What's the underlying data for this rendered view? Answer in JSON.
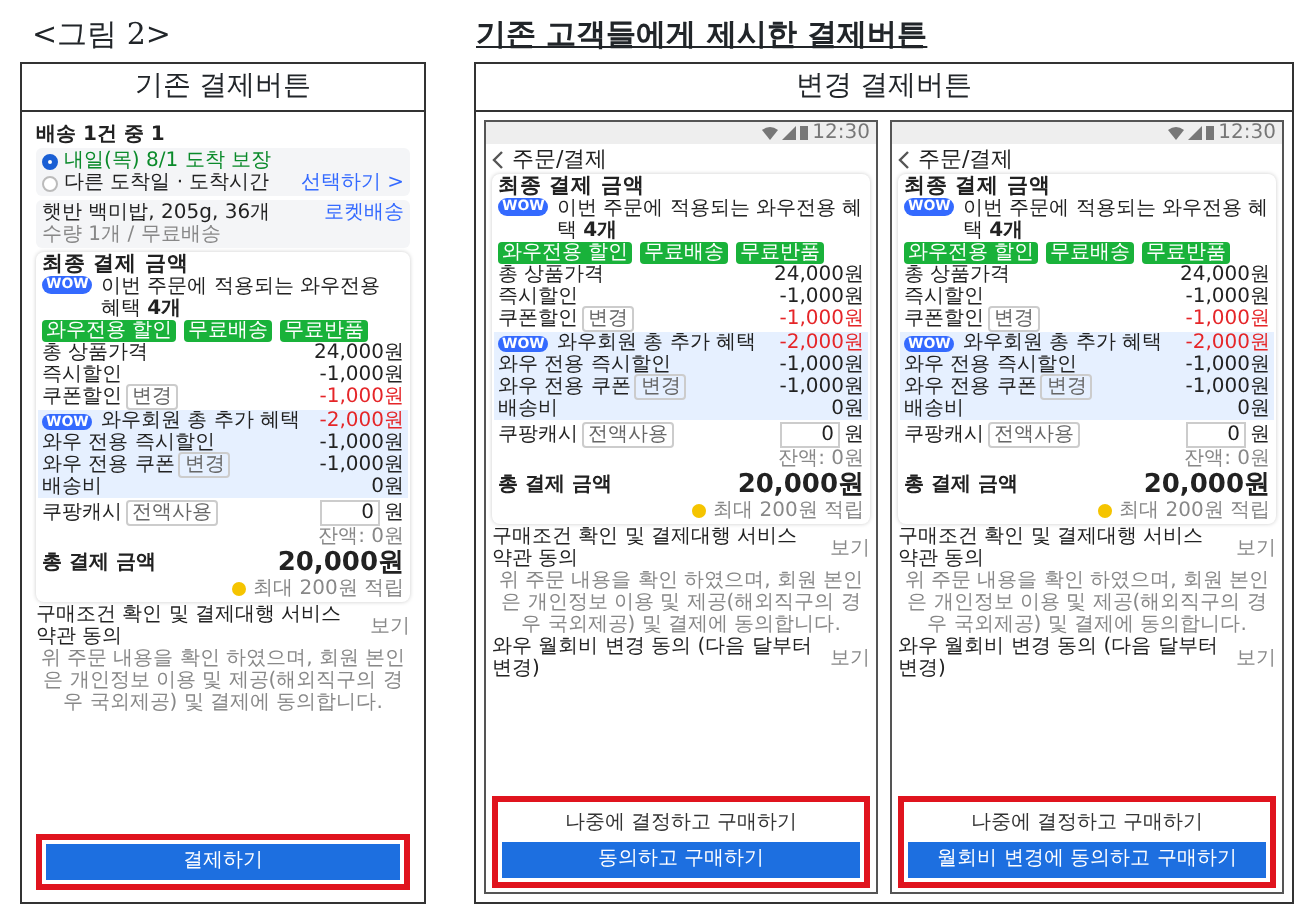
{
  "figure": {
    "caption": "<그림 2>",
    "title": "기존 고객들에게 제시한 결제버튼"
  },
  "panels": [
    {
      "heading": "기존 결제버튼",
      "screens": [
        {
          "delivery": {
            "title": "배송 1건 중 1",
            "options": [
              {
                "label": "내일(목) 8/1 도착 보장",
                "selected": true
              },
              {
                "label": "다른 도착일 · 도착시간",
                "selected": false,
                "action": "선택하기 >"
              }
            ],
            "product": "햇반 백미밥, 205g, 36개",
            "badge": "로켓배송",
            "note": "수량 1개 / 무료배송"
          },
          "summary": {
            "title": "최종 결제 금액",
            "wow_label": "WOW",
            "wow_text": "이번 주문에 적용되는 와우전용 혜택 **4개**",
            "tags": [
              "와우전용 할인",
              "무료배송",
              "무료반품"
            ],
            "rows": [
              {
                "label": "총 상품가격",
                "value": "24,000원",
                "color": "#222222"
              },
              {
                "label": "즉시할인",
                "value": "-1,000원",
                "color": "#222222"
              },
              {
                "label": "쿠폰할인",
                "chip": "변경",
                "value": "-1,000원",
                "color": "#e52528"
              }
            ],
            "wow_block": {
              "label": "WOW",
              "title": "와우회원 총 추가 혜택",
              "value": "-2,000원",
              "rows": [
                {
                  "label": "와우 전용 즉시할인",
                  "value": "-1,000원"
                },
                {
                  "label": "와우 전용 쿠폰",
                  "chip": "변경",
                  "value": "-1,000원"
                },
                {
                  "label": "배송비",
                  "value": "0원"
                }
              ]
            },
            "cash": {
              "label": "쿠팡캐시",
              "chip": "전액사용",
              "value": "0",
              "unit": "원",
              "balance": "잔액: 0원"
            },
            "total_label": "총 결제 금액",
            "total": "20,000원",
            "reward": "최대 200원 적립"
          },
          "footer": [
            {
              "kind": "term",
              "text": "구매조건 확인 및 결제대행 서비스 약관 동의",
              "action": "보기"
            },
            {
              "kind": "notice",
              "text": "위 주문 내용을 확인 하였으며, 회원 본인은 개인정보 이용 및 제공(해외직구의 경우 국외제공) 및 결제에 동의합니다."
            }
          ],
          "button_area": {
            "highlighted": true,
            "buttons": [
              {
                "label": "결제하기",
                "kind": "primary"
              }
            ]
          }
        }
      ]
    },
    {
      "heading": "변경 결제버튼",
      "screens": [
        {
          "status_time": "12:30",
          "header": "주문/결제",
          "summary": {
            "title": "최종 결제 금액",
            "wow_label": "WOW",
            "wow_text": "이번 주문에 적용되는 와우전용 혜택 **4개**",
            "tags": [
              "와우전용 할인",
              "무료배송",
              "무료반품"
            ],
            "rows": [
              {
                "label": "총 상품가격",
                "value": "24,000원",
                "color": "#222222"
              },
              {
                "label": "즉시할인",
                "value": "-1,000원",
                "color": "#222222"
              },
              {
                "label": "쿠폰할인",
                "chip": "변경",
                "value": "-1,000원",
                "color": "#e52528"
              }
            ],
            "wow_block": {
              "label": "WOW",
              "title": "와우회원 총 추가 혜택",
              "value": "-2,000원",
              "rows": [
                {
                  "label": "와우 전용 즉시할인",
                  "value": "-1,000원"
                },
                {
                  "label": "와우 전용 쿠폰",
                  "chip": "변경",
                  "value": "-1,000원"
                },
                {
                  "label": "배송비",
                  "value": "0원"
                }
              ]
            },
            "cash": {
              "label": "쿠팡캐시",
              "chip": "전액사용",
              "value": "0",
              "unit": "원",
              "balance": "잔액: 0원"
            },
            "total_label": "총 결제 금액",
            "total": "20,000원",
            "reward": "최대 200원 적립"
          },
          "footer": [
            {
              "kind": "term",
              "text": "구매조건 확인 및 결제대행 서비스 약관 동의",
              "action": "보기"
            },
            {
              "kind": "notice",
              "text": "위 주문 내용을 확인 하였으며, 회원 본인은 개인정보 이용 및 제공(해외직구의 경우 국외제공) 및 결제에 동의합니다."
            },
            {
              "kind": "term",
              "text": "와우 월회비 변경 동의 (다음 달부터 변경)",
              "action": "보기"
            }
          ],
          "button_area": {
            "highlighted": true,
            "buttons": [
              {
                "label": "나중에 결정하고 구매하기",
                "kind": "secondary"
              },
              {
                "label": "동의하고 구매하기",
                "kind": "primary"
              }
            ]
          }
        },
        {
          "status_time": "12:30",
          "header": "주문/결제",
          "summary": {
            "title": "최종 결제 금액",
            "wow_label": "WOW",
            "wow_text": "이번 주문에 적용되는 와우전용 혜택 **4개**",
            "tags": [
              "와우전용 할인",
              "무료배송",
              "무료반품"
            ],
            "rows": [
              {
                "label": "총 상품가격",
                "value": "24,000원",
                "color": "#222222"
              },
              {
                "label": "즉시할인",
                "value": "-1,000원",
                "color": "#222222"
              },
              {
                "label": "쿠폰할인",
                "chip": "변경",
                "value": "-1,000원",
                "color": "#e52528"
              }
            ],
            "wow_block": {
              "label": "WOW",
              "title": "와우회원 총 추가 혜택",
              "value": "-2,000원",
              "rows": [
                {
                  "label": "와우 전용 즉시할인",
                  "value": "-1,000원"
                },
                {
                  "label": "와우 전용 쿠폰",
                  "chip": "변경",
                  "value": "-1,000원"
                },
                {
                  "label": "배송비",
                  "value": "0원"
                }
              ]
            },
            "cash": {
              "label": "쿠팡캐시",
              "chip": "전액사용",
              "value": "0",
              "unit": "원",
              "balance": "잔액: 0원"
            },
            "total_label": "총 결제 금액",
            "total": "20,000원",
            "reward": "최대 200원 적립"
          },
          "footer": [
            {
              "kind": "term",
              "text": "구매조건 확인 및 결제대행 서비스 약관 동의",
              "action": "보기"
            },
            {
              "kind": "notice",
              "text": "위 주문 내용을 확인 하였으며, 회원 본인은 개인정보 이용 및 제공(해외직구의 경우 국외제공) 및 결제에 동의합니다."
            },
            {
              "kind": "term",
              "text": "와우 월회비 변경 동의 (다음 달부터 변경)",
              "action": "보기"
            }
          ],
          "button_area": {
            "highlighted": true,
            "buttons": [
              {
                "label": "나중에 결정하고 구매하기",
                "kind": "secondary"
              },
              {
                "label": "월회비 변경에 동의하고 구매하기",
                "kind": "primary"
              }
            ]
          }
        }
      ]
    }
  ]
}
